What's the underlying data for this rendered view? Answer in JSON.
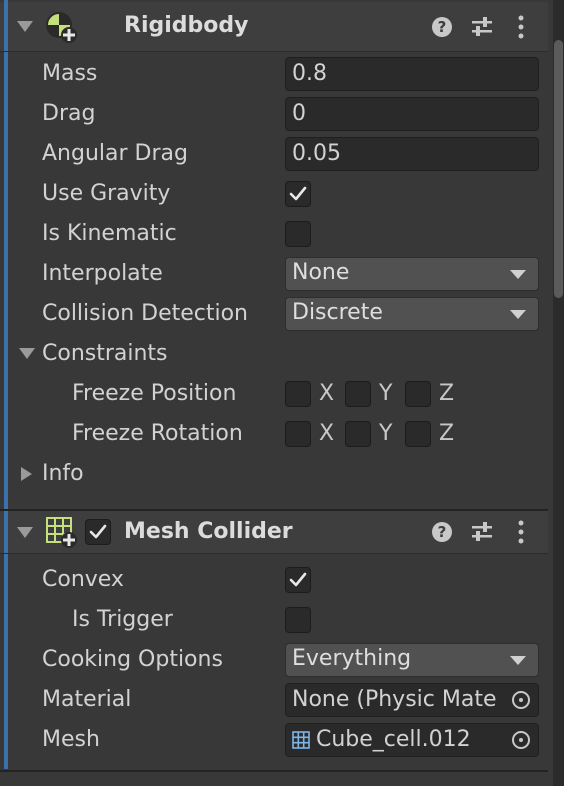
{
  "rigidbody": {
    "title": "Rigidbody",
    "mass_label": "Mass",
    "mass_value": "0.8",
    "drag_label": "Drag",
    "drag_value": "0",
    "angular_drag_label": "Angular Drag",
    "angular_drag_value": "0.05",
    "use_gravity_label": "Use Gravity",
    "use_gravity_checked": true,
    "is_kinematic_label": "Is Kinematic",
    "is_kinematic_checked": false,
    "interpolate_label": "Interpolate",
    "interpolate_value": "None",
    "collision_label": "Collision Detection",
    "collision_value": "Discrete",
    "constraints_label": "Constraints",
    "freeze_position_label": "Freeze Position",
    "freeze_rotation_label": "Freeze Rotation",
    "axis_x": "X",
    "axis_y": "Y",
    "axis_z": "Z",
    "info_label": "Info"
  },
  "mesh_collider": {
    "title": "Mesh Collider",
    "enabled": true,
    "convex_label": "Convex",
    "convex_checked": true,
    "is_trigger_label": "Is Trigger",
    "is_trigger_checked": false,
    "cooking_label": "Cooking Options",
    "cooking_value": "Everything",
    "material_label": "Material",
    "material_value": "None (Physic Mate",
    "mesh_label": "Mesh",
    "mesh_value": "Cube_cell.012"
  },
  "icons": {
    "rigidbody": "rigidbody-component-icon",
    "mesh_collider": "mesh-collider-component-icon",
    "help": "help-icon",
    "presets": "presets-sliders-icon",
    "menu": "kebab-menu-icon",
    "check": "checkmark-icon",
    "object_picker": "object-picker-icon",
    "mesh": "mesh-asset-icon"
  },
  "colors": {
    "background": "#383838",
    "header": "#3e3e3e",
    "accent": "#3a72b0",
    "field": "#2a2a2a",
    "dropdown": "#515151",
    "icon_green": "#c3e07c"
  }
}
